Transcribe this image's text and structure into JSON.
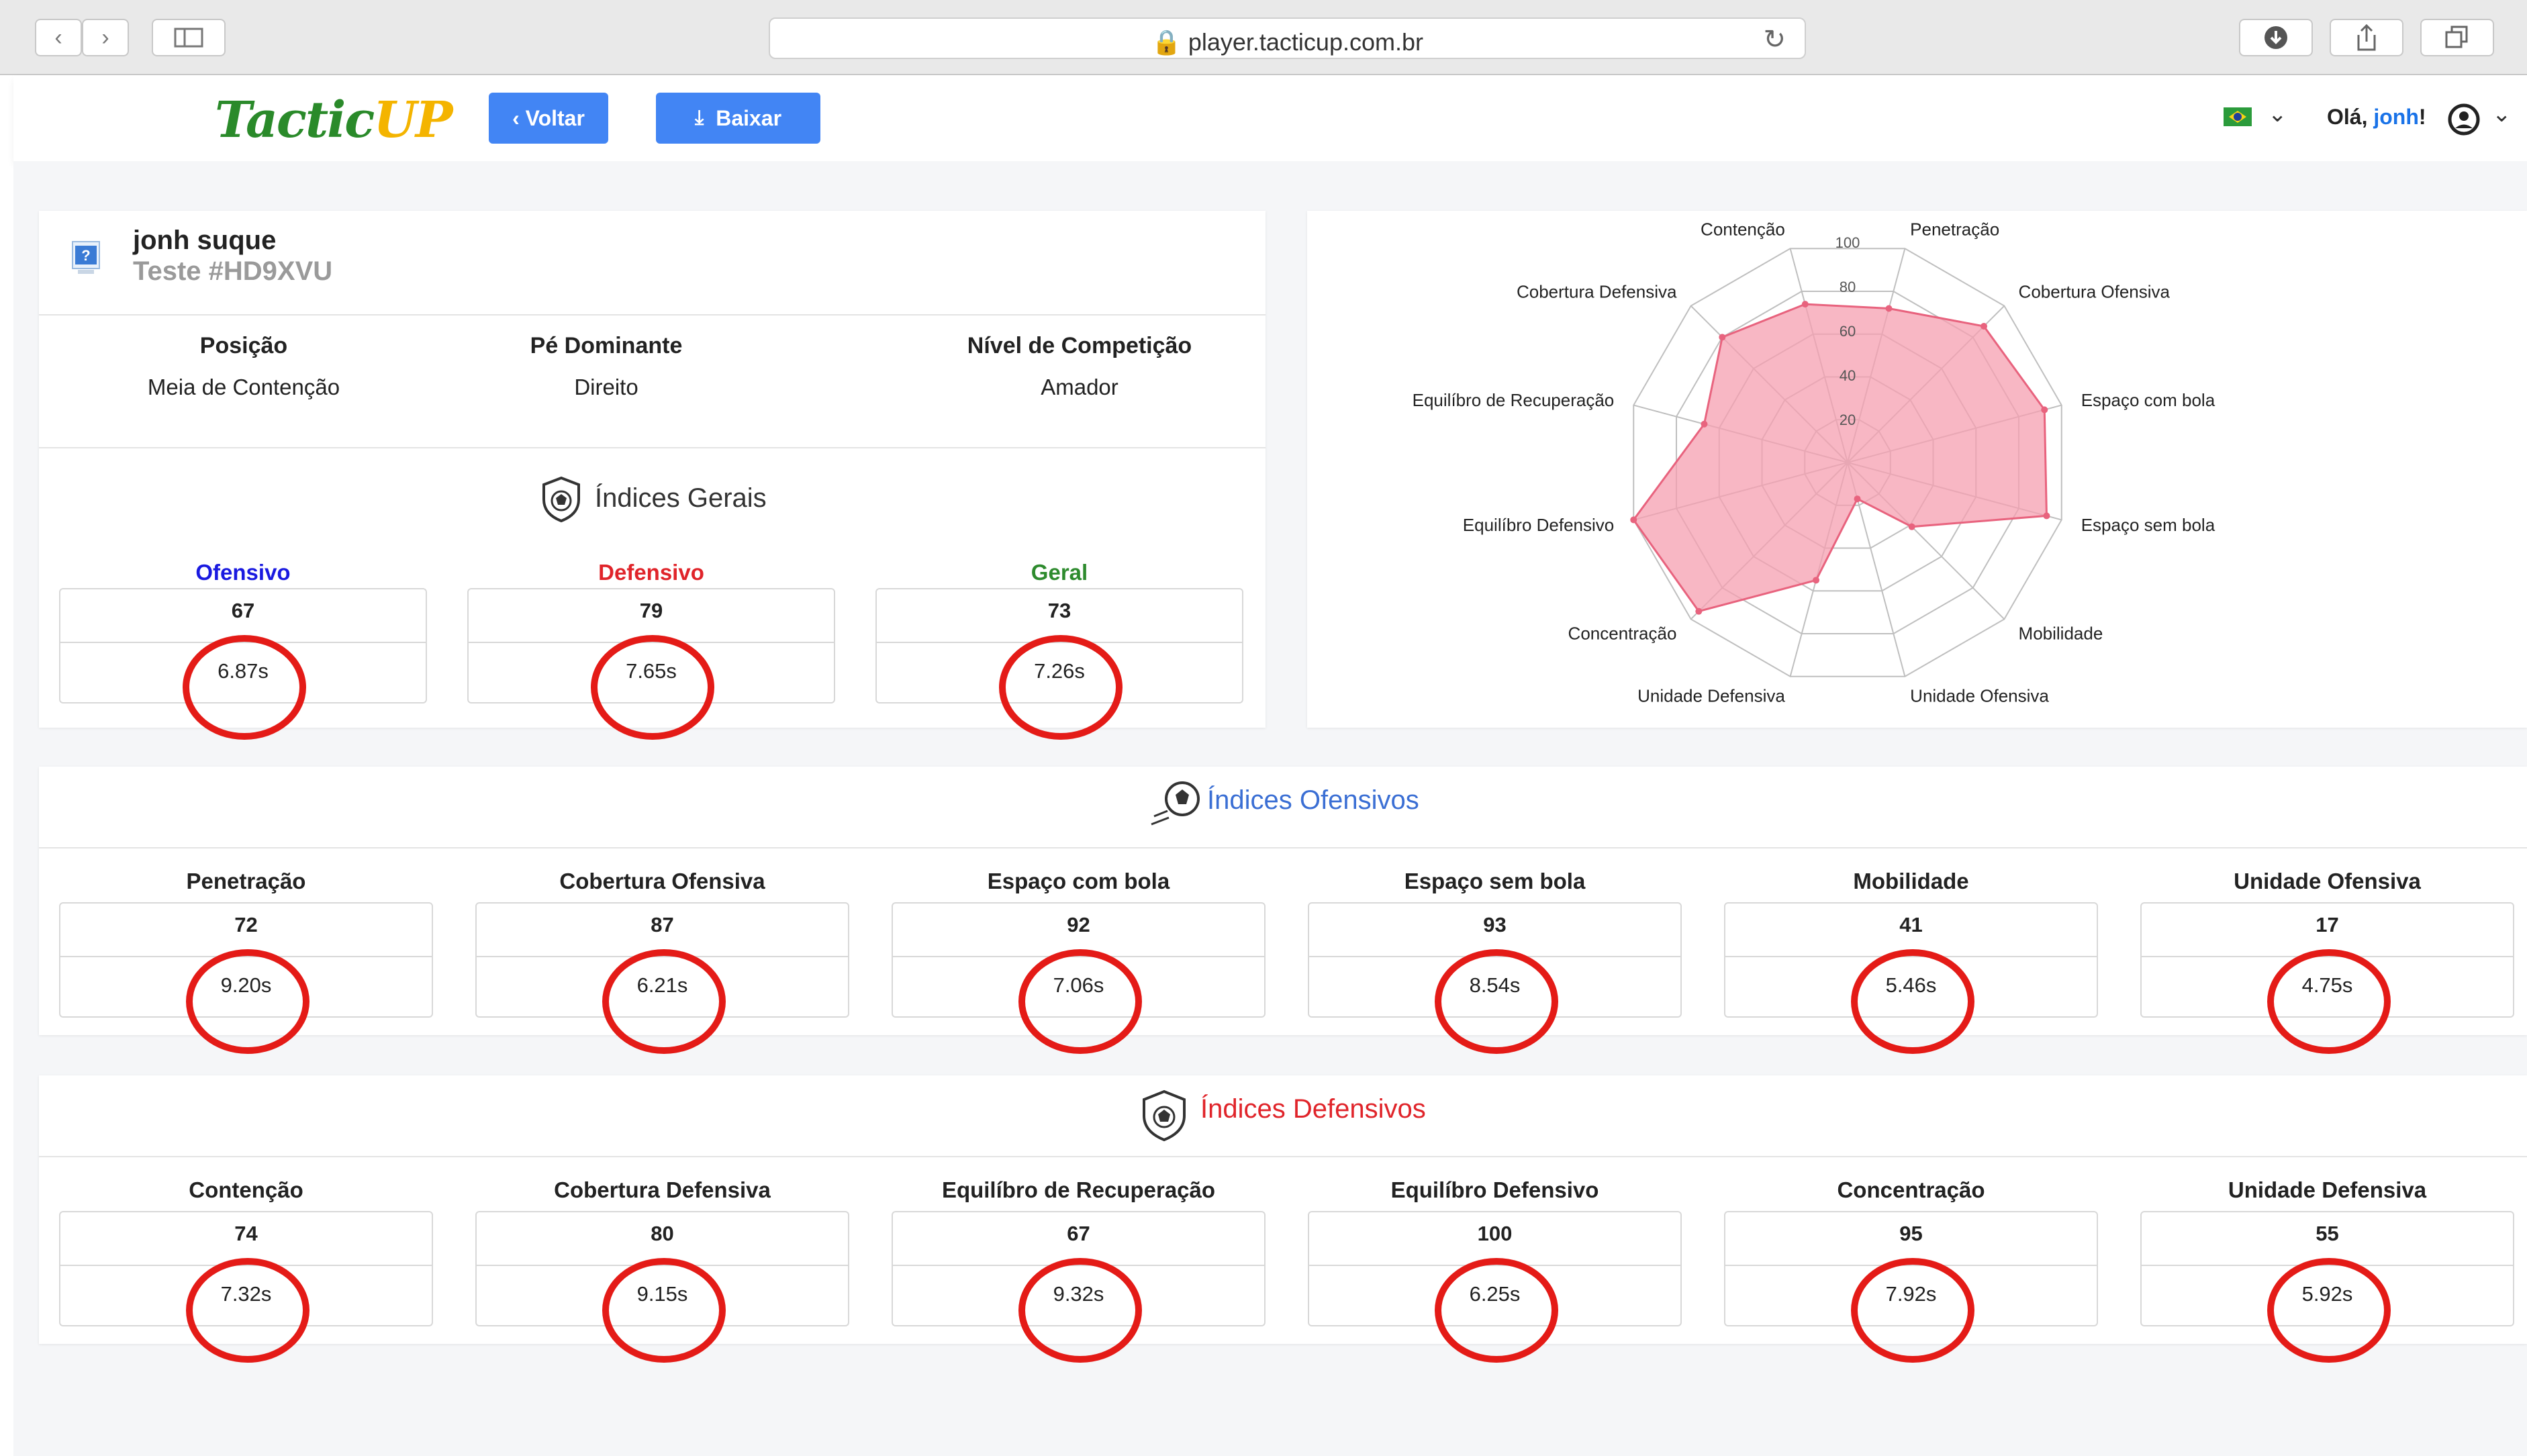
{
  "browser": {
    "url": "player.tacticup.com.br"
  },
  "header": {
    "logo_main": "TacticUP",
    "logo_a": "Tactic",
    "logo_b": "UP",
    "back_label": "‹ Voltar",
    "download_label": "Baixar",
    "greeting_prefix": "Olá,",
    "user_name": "jonh",
    "greeting_suffix": "!"
  },
  "profile": {
    "name": "jonh suque",
    "test_code": "Teste #HD9XVU",
    "fields": [
      {
        "label": "Posição",
        "value": "Meia de Contenção"
      },
      {
        "label": "Pé Dominante",
        "value": "Direito"
      },
      {
        "label": "Nível de Competição",
        "value": "Amador"
      }
    ]
  },
  "general": {
    "title": "Índices Gerais",
    "items": [
      {
        "label": "Ofensivo",
        "value": "67",
        "time": "6.87s",
        "color": "#1a1ae0"
      },
      {
        "label": "Defensivo",
        "value": "79",
        "time": "7.65s",
        "color": "#e0242a"
      },
      {
        "label": "Geral",
        "value": "73",
        "time": "7.26s",
        "color": "#2e8b2e"
      }
    ]
  },
  "offensive": {
    "title": "Índices Ofensivos",
    "items": [
      {
        "label": "Penetração",
        "value": "72",
        "time": "9.20s"
      },
      {
        "label": "Cobertura Ofensiva",
        "value": "87",
        "time": "6.21s"
      },
      {
        "label": "Espaço com bola",
        "value": "92",
        "time": "7.06s"
      },
      {
        "label": "Espaço sem bola",
        "value": "93",
        "time": "8.54s"
      },
      {
        "label": "Mobilidade",
        "value": "41",
        "time": "5.46s"
      },
      {
        "label": "Unidade Ofensiva",
        "value": "17",
        "time": "4.75s"
      }
    ]
  },
  "defensive": {
    "title": "Índices Defensivos",
    "items": [
      {
        "label": "Contenção",
        "value": "74",
        "time": "7.32s"
      },
      {
        "label": "Cobertura Defensiva",
        "value": "80",
        "time": "9.15s"
      },
      {
        "label": "Equilíbro de Recuperação",
        "value": "67",
        "time": "9.32s"
      },
      {
        "label": "Equilíbro Defensivo",
        "value": "100",
        "time": "6.25s"
      },
      {
        "label": "Concentração",
        "value": "95",
        "time": "7.92s"
      },
      {
        "label": "Unidade Defensiva",
        "value": "55",
        "time": "5.92s"
      }
    ]
  },
  "colors": {
    "accent": "#4285f4",
    "offensive_title": "#3b6fd4",
    "defensive_title": "#e0242a",
    "ring": "#e41b17",
    "radar_fill": "#f59fb0",
    "radar_stroke": "#e8637e"
  },
  "chart_data": {
    "type": "radar",
    "categories": [
      "Penetração",
      "Cobertura Ofensiva",
      "Espaço com bola",
      "Espaço sem bola",
      "Mobilidade",
      "Unidade Ofensiva",
      "Unidade Defensiva",
      "Concentração",
      "Equilíbro Defensivo",
      "Equilíbro de Recuperação",
      "Cobertura Defensiva",
      "Contenção"
    ],
    "values": [
      72,
      87,
      92,
      93,
      41,
      17,
      55,
      95,
      100,
      67,
      80,
      74
    ],
    "ticks": [
      "20",
      "40",
      "60",
      "80",
      "100"
    ],
    "rlim": [
      0,
      100
    ]
  }
}
